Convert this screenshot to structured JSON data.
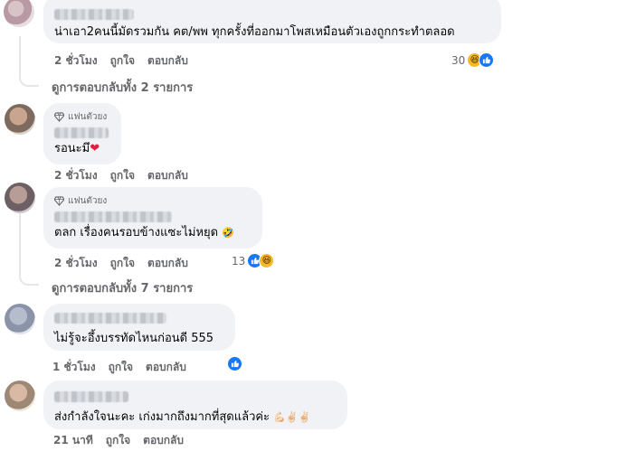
{
  "comments": [
    {
      "text": "น่าเอา2คนนี้มัดรวมกัน คต/พพ ทุกครั้งที่ออกมาโพสเหมือนตัวเองถูกกระทำตลอด",
      "time": "2 ชั่วโมง",
      "like": "ถูกใจ",
      "reply": "ตอบกลับ",
      "reaction_count": "30",
      "replies_text": "ดูการตอบกลับทั้ง 2 รายการ"
    },
    {
      "badge": "แฟนตัวยง",
      "text": "รอนะมึ",
      "emoji": "❤",
      "time": "2 ชั่วโมง",
      "like": "ถูกใจ",
      "reply": "ตอบกลับ"
    },
    {
      "badge": "แฟนตัวยง",
      "text": "ตลก เรื่องคนรอบข้างแซะไม่หยุด",
      "emoji": "🤣",
      "time": "2 ชั่วโมง",
      "like": "ถูกใจ",
      "reply": "ตอบกลับ",
      "reaction_count": "13",
      "replies_text": "ดูการตอบกลับทั้ง 7 รายการ"
    },
    {
      "text": "ไม่รู้จะอึ้งบรรทัดไหนก่อนดี 555",
      "time": "1 ชั่วโมง",
      "like": "ถูกใจ",
      "reply": "ตอบกลับ"
    },
    {
      "text": "ส่งกำลังใจนะคะ เก่งมากถึงมากที่สุดแล้วค่ะ",
      "emoji": "💪🏻✌🏻✌🏻",
      "time": "21 นาที",
      "like": "ถูกใจ",
      "reply": "ตอบกลับ"
    }
  ],
  "icons": {
    "like": "like-reaction-icon",
    "haha": "haha-reaction-icon",
    "badge": "diamond-icon"
  },
  "colors": {
    "bubble": "#f0f2f5",
    "meta": "#65676b",
    "like_blue": "#1877f2",
    "haha_yellow": "#f7b928"
  }
}
